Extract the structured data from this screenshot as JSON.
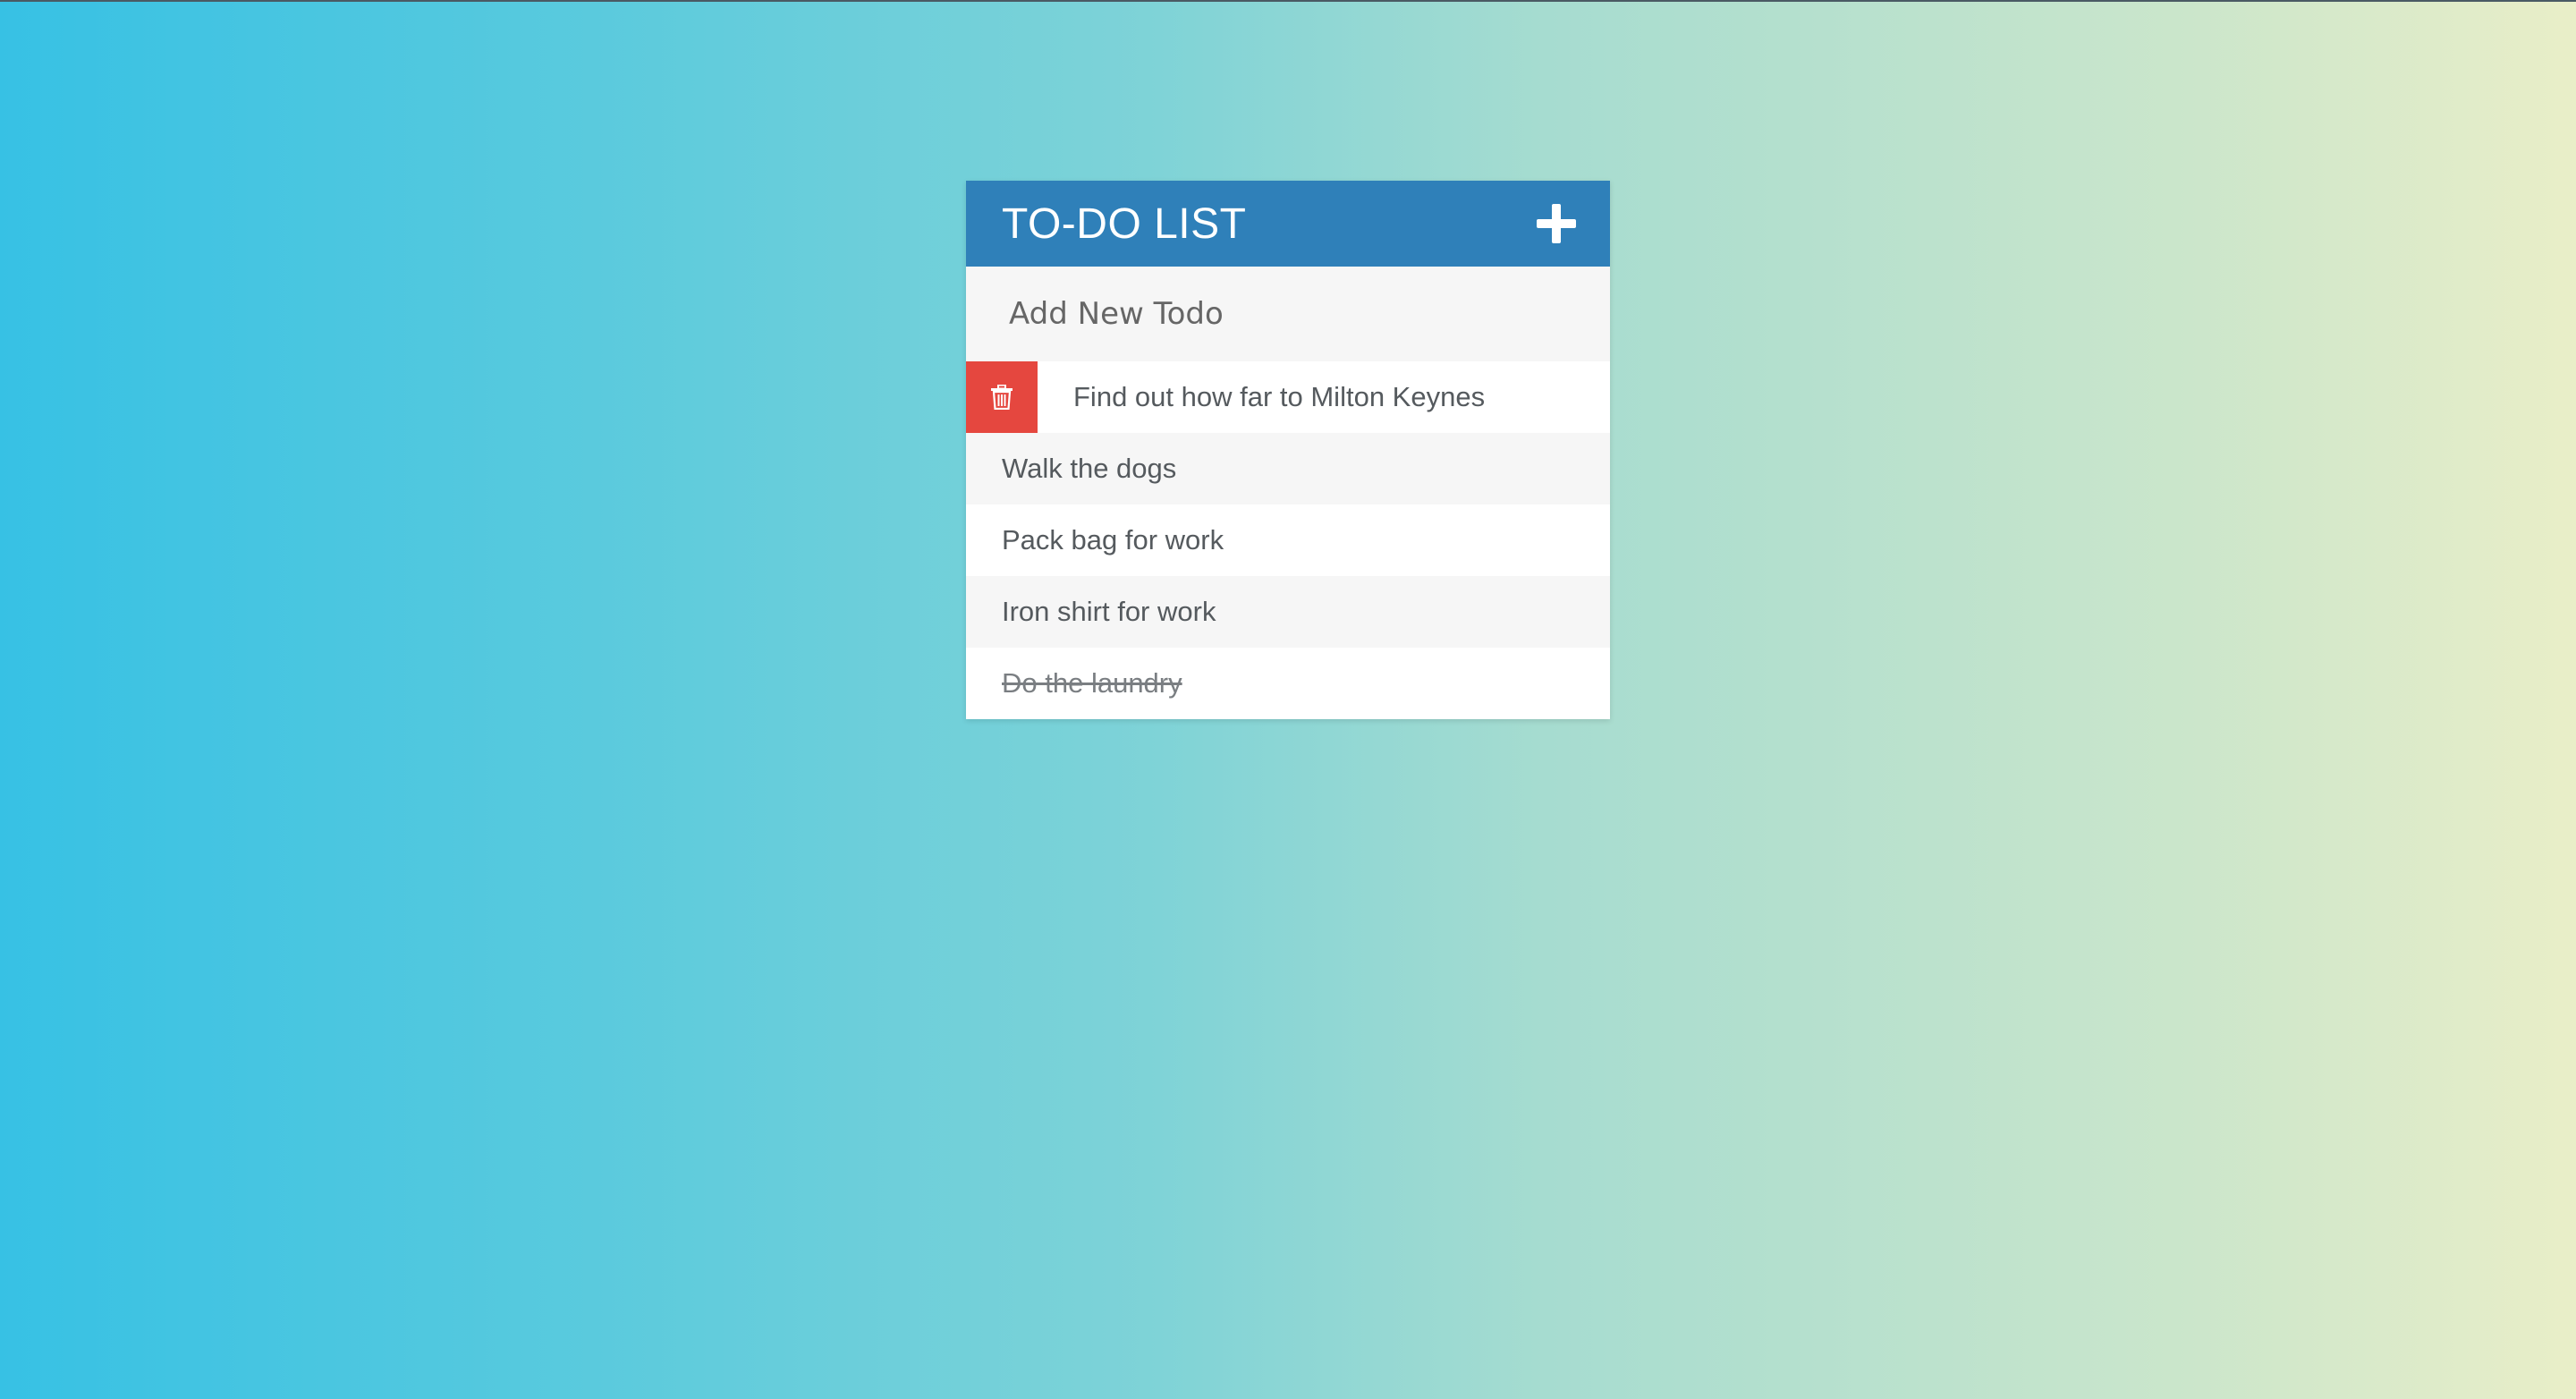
{
  "header": {
    "title": "TO-DO LIST",
    "add_icon": "plus-icon"
  },
  "new_todo": {
    "placeholder": "Add New Todo",
    "value": ""
  },
  "todos": [
    {
      "text": "Find out how far to Milton Keynes",
      "completed": false,
      "delete_visible": true
    },
    {
      "text": "Walk the dogs",
      "completed": false,
      "delete_visible": false
    },
    {
      "text": "Pack bag for work",
      "completed": false,
      "delete_visible": false
    },
    {
      "text": "Iron shirt for work",
      "completed": false,
      "delete_visible": false
    },
    {
      "text": "Do the laundry",
      "completed": true,
      "delete_visible": false
    }
  ],
  "colors": {
    "header_bg": "#2f80b9",
    "delete_bg": "#e5473f",
    "row_alt_bg": "#f6f6f6",
    "text": "#555a5e"
  },
  "icons": {
    "delete": "trash-icon",
    "add": "plus-icon"
  }
}
